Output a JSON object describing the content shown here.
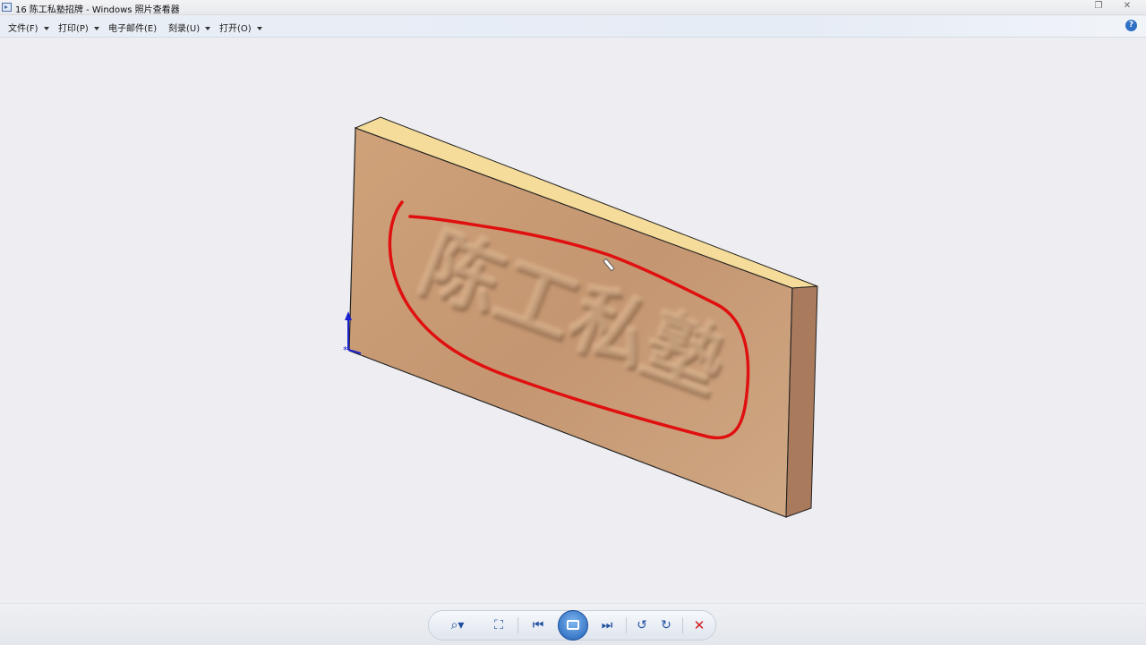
{
  "window": {
    "title": "16 陈工私塾招牌 - Windows 照片查看器",
    "icons": [
      "photo-viewer-icon",
      "restore-icon",
      "close-icon"
    ]
  },
  "menu": {
    "items": [
      {
        "label": "文件(F)"
      },
      {
        "label": "打印(P)"
      },
      {
        "label": "电子邮件(E)"
      },
      {
        "label": "刻录(U)"
      },
      {
        "label": "打开(O)"
      }
    ],
    "help_icon": "help-icon"
  },
  "image": {
    "subject": "3D wooden signboard with raised characters",
    "engraved_text": "陈工私塾",
    "annotation_color": "#e01010",
    "board_face_color": "#c89a72",
    "board_top_color": "#f6dc9a",
    "board_side_color": "#a97a5c"
  },
  "controls": [
    {
      "name": "zoom-button",
      "icon": "magnifier-icon"
    },
    {
      "name": "actual-size-button",
      "icon": "fit-window-icon"
    },
    {
      "name": "previous-button",
      "icon": "previous-icon"
    },
    {
      "name": "slideshow-button",
      "icon": "slideshow-icon"
    },
    {
      "name": "next-button",
      "icon": "next-icon"
    },
    {
      "name": "rotate-left-button",
      "icon": "rotate-ccw-icon"
    },
    {
      "name": "rotate-right-button",
      "icon": "rotate-cw-icon"
    },
    {
      "name": "delete-button",
      "icon": "delete-icon"
    }
  ]
}
